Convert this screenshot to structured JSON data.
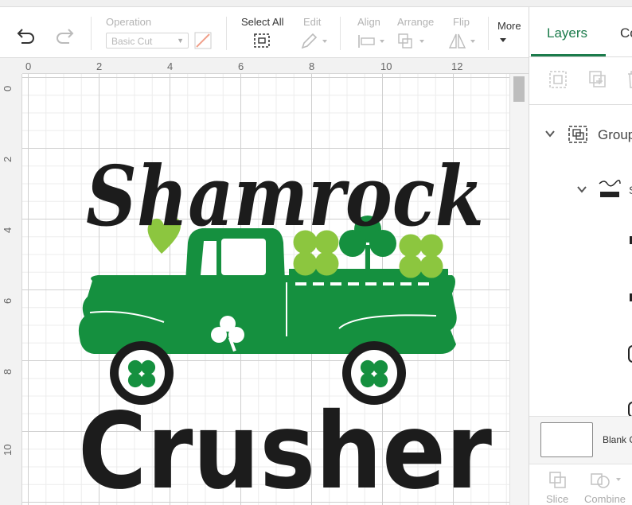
{
  "toolbar": {
    "operation_label": "Operation",
    "operation_value": "Basic Cut",
    "select_all_label": "Select All",
    "edit_label": "Edit",
    "align_label": "Align",
    "arrange_label": "Arrange",
    "flip_label": "Flip",
    "more_label": "More"
  },
  "rulers": {
    "top": [
      "0",
      "2",
      "4",
      "6",
      "8",
      "10",
      "12"
    ],
    "left": [
      "0",
      "2",
      "4",
      "6",
      "8",
      "10"
    ]
  },
  "artwork": {
    "title_top": "Shamrock",
    "title_bottom": "Crusher",
    "colors": {
      "dark_green": "#15903f",
      "light_green": "#8cc63f",
      "black": "#1c1c1c"
    }
  },
  "panel": {
    "tabs": [
      "Layers",
      "Co"
    ],
    "group_label": "Group",
    "sub_item_initial": "S",
    "blank_label": "Blank C",
    "slice_label": "Slice",
    "combine_label": "Combine"
  },
  "colors": {
    "accent": "#1b7b4b"
  }
}
